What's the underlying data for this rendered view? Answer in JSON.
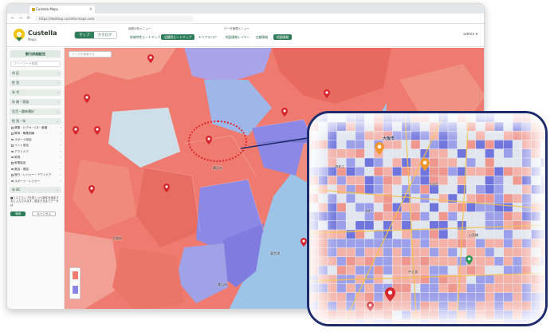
{
  "browser": {
    "tab_title": "Custella Maps",
    "url": "https://desktop.custella-maps.com",
    "nav_glyphs": "← → ⟳"
  },
  "header": {
    "logo_name": "Custella",
    "logo_sub": "Maps",
    "modes": [
      "マップ",
      "カタログ"
    ],
    "group1_label": "地図分析メニュー",
    "group1_buttons": [
      "地域特性ヒートマップ",
      "店舗別ヒートマップ",
      "エリアスコア"
    ],
    "group2_label": "データ管理メニュー",
    "group2_buttons": [
      "地図情報レイヤー",
      "店舗情報",
      "地図情報"
    ],
    "user": "admin ▾"
  },
  "sidebar": {
    "title": "割引詳細設定",
    "search_placeholder": "フリーワード検索",
    "categories": [
      {
        "label": "市 区"
      },
      {
        "label": "性 別"
      },
      {
        "label": "年 代"
      },
      {
        "label": "年 齢・家族"
      },
      {
        "label": "生活・趣味嗜好"
      }
    ],
    "subitems": [
      "健康・ビデオ・CD・楽器",
      "教育・職業訓練",
      "スポーツ用品",
      "ペット用品",
      "アウトドア",
      "家具",
      "家電製品",
      "美容・理容",
      "旅行・レジャー・アウトドア",
      "スポーツ・レジャー"
    ],
    "category_more": "性 別・年",
    "category_last": "年 BC",
    "note": "■リスクマップを表しつつ条件を設定すると入力されます。設定するまでデータは",
    "apply_label": "適用",
    "reset_label": "キャンセル"
  },
  "map": {
    "search_placeholder": "マップを検索する",
    "zoom_in": "+",
    "zoom_out": "−",
    "pin_label": "店舗",
    "places": [
      "横浜市",
      "東京湾",
      "館山市",
      "大和市"
    ],
    "colors": {
      "high": "#ef7b70",
      "low": "#8c88e5",
      "water": "#9cc3e8",
      "land": "#cde3d7"
    }
  },
  "zoom_bubble": {
    "places": [
      "大阪市",
      "海老江",
      "大淀区",
      "本町",
      "心斎橋",
      "中之島"
    ]
  },
  "accent": {
    "brand_green": "#2e7d5b",
    "highlight_red": "#e0262e",
    "bubble_border": "#1e2c6d"
  }
}
